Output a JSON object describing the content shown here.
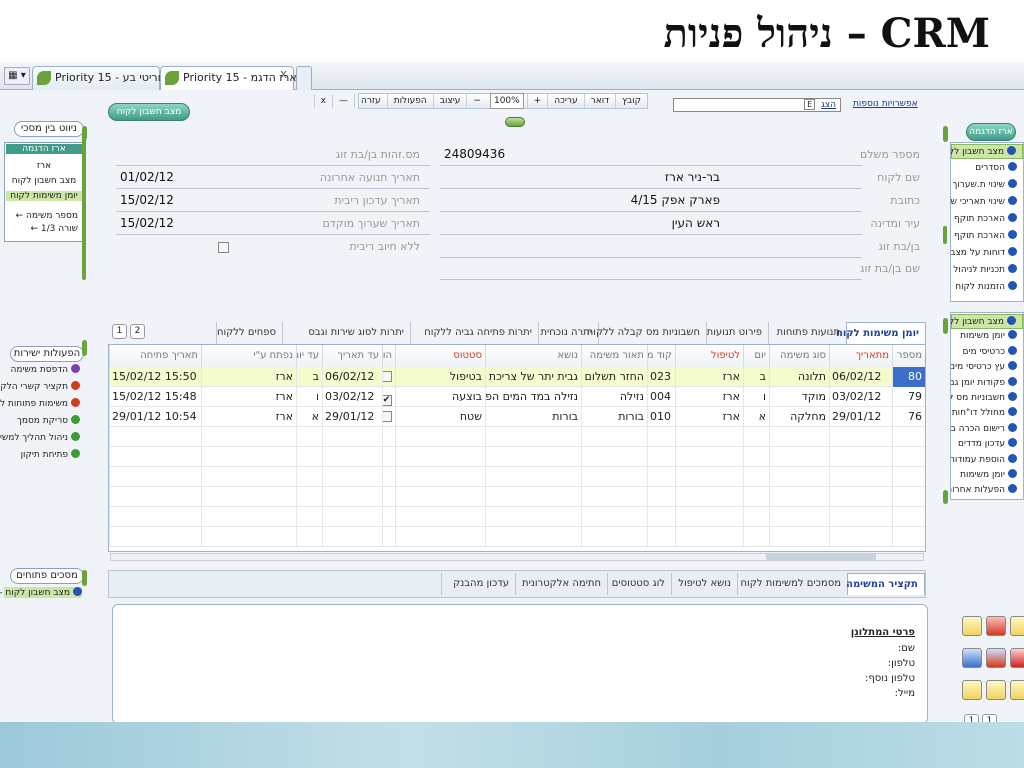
{
  "slide": {
    "title": "CRM – ניהול פניות"
  },
  "browser": {
    "tabs": [
      {
        "label": "Priority 15 - פריוריטי בע...",
        "active": false
      },
      {
        "label": "Priority 15 - ארז הדגמ...",
        "active": true
      }
    ],
    "close_glyph": "x"
  },
  "toolbar": {
    "items": [
      "קובץ",
      "דואר",
      "עריכה",
      "+",
      "100%",
      "−",
      "עיצוב",
      "הפעולות",
      "עזרה",
      "—",
      "x"
    ],
    "search_go": "הצג",
    "search_icon": "E",
    "more_options": "אפשרויות נוספות",
    "button_customer_status": "מצב חשבון לקוח"
  },
  "left_panel": {
    "nav_title": "ניווט בין מסכי",
    "nav_items": [
      "ארז הדגמה",
      "ארז",
      "מצב חשבון לקוח",
      "יומן משימות לקוח"
    ],
    "tree_items": [
      "מספר משימה",
      "שורה 1/3"
    ],
    "actions_title": "הפעולות ישירות",
    "actions": [
      {
        "label": "הדפסת משימה",
        "color": "#7a3fb0"
      },
      {
        "label": "תקציר קשרי הלקו",
        "color": "#d23a1e"
      },
      {
        "label": "משימות פתוחות ל",
        "color": "#d23a1e"
      },
      {
        "label": "סריקת מסמך",
        "color": "#3f9a3a"
      },
      {
        "label": "ניהול תהליך למשי",
        "color": "#3f9a3a"
      },
      {
        "label": "פתיחת תיקון",
        "color": "#3f9a3a"
      }
    ],
    "open_screens_title": "מסכים פתוחים",
    "open_screens": [
      "מצב חשבון לקוח -"
    ]
  },
  "right_nav": {
    "title": "ארז הדגמה",
    "group1": [
      "מצב חשבון לקוח",
      "הסדרים",
      "שינוי ת.שערוך בחש",
      "שינוי תאריכי שערוך",
      "הארכת תוקף הסדר",
      "הארכת תוקף כרטיס",
      "דוחות על מצב חשבו",
      "תכניות לניהול מצב ר",
      "הזמנות לקוח"
    ],
    "group2": [
      "מצב חשבון לקוח",
      "יומן משימות",
      "כרטיסי מים",
      "עץ כרטיסי מים",
      "פקודות יומן גביה",
      "חשבוניות מס קבלה",
      "מחולל דו\"חות ראשי",
      "רישום הכרה בהכנסו",
      "עדכון מדדים",
      "הוספת עמודות למסך",
      "יומן משימות",
      "הפעלות אחרונות"
    ]
  },
  "form": {
    "fields_right": [
      {
        "label": "מספר משלם",
        "value": "24809436"
      },
      {
        "label": "שם לקוח",
        "value": "בר-ניר ארז"
      },
      {
        "label": "כתובת",
        "value": "פארק אפק 4/15"
      },
      {
        "label": "עיר ומדינה",
        "value": "ראש העין"
      },
      {
        "label": "בן/בת זוג",
        "value": ""
      },
      {
        "label": "שם בן/בת זוג",
        "value": ""
      }
    ],
    "fields_left": [
      {
        "label": "מס.זהות בן/בת זוג",
        "value": ""
      },
      {
        "label": "תאריך תנועה אחרונה",
        "value": "01/02/12"
      },
      {
        "label": "תאריך עדכון ריבית",
        "value": "15/02/12"
      },
      {
        "label": "תאריך שערוך מוקדם",
        "value": "15/02/12"
      },
      {
        "label": "ללא חיוב ריבית",
        "value": ""
      }
    ]
  },
  "subform_tabs": {
    "items": [
      "יומן משימות לקוח",
      "תנועות פתוחות",
      "פירוט תנועות",
      "חשבוניות מס קבלה ללקוח",
      "יתרה נוכחית",
      "יתרות פתיחה גביה ללקוח",
      "יתרות לסוג שירות וגבס",
      "ספחים ללקוח"
    ],
    "pages": [
      "2",
      "1"
    ]
  },
  "grid": {
    "columns": [
      "מספר",
      "מתאריך",
      "סוג משימה",
      "יום",
      "לטיפול",
      "קוד מ",
      "תאור משימה",
      "נושא",
      "סטטוס",
      "הו",
      "עד תאריך",
      "עד יום",
      "נפתח ע\"י",
      "תאריך פתיחה"
    ],
    "rows": [
      {
        "num": "80",
        "from_date": "06/02/12",
        "type": "תלונה",
        "day": "ב",
        "handler": "ארז",
        "code": "023",
        "desc": "החזר תשלום",
        "subject": "גבית יתר של צריכת מים",
        "status": "בטיפול",
        "done": false,
        "to_date": "06/02/12",
        "to_day": "ב",
        "opened_by": "ארז",
        "opened_at": "15/02/12 15:50"
      },
      {
        "num": "79",
        "from_date": "03/02/12",
        "type": "מוקד",
        "day": "ו",
        "handler": "ארז",
        "code": "004",
        "desc": "נזילה",
        "subject": "נזילה במד המים הפרטי",
        "status": "בוצעה",
        "done": true,
        "to_date": "03/02/12",
        "to_day": "ו",
        "opened_by": "ארז",
        "opened_at": "15/02/12 15:48"
      },
      {
        "num": "76",
        "from_date": "29/01/12",
        "type": "מחלקה",
        "day": "א",
        "handler": "ארז",
        "code": "010",
        "desc": "בורות",
        "subject": "בורות",
        "status": "שטח",
        "done": false,
        "to_date": "29/01/12",
        "to_day": "א",
        "opened_by": "ארז",
        "opened_at": "29/01/12 10:54"
      }
    ]
  },
  "bottom_tabs": [
    "תקציר המשימה",
    "מסמכים למשימות לקוח",
    "נושא לטיפול",
    "לוג סטטוסים",
    "חתימה אלקטרונית",
    "עדכון מהבנק"
  ],
  "detail": {
    "title": "פרטי המתלונן",
    "lines": [
      "שם:",
      "טלפון:",
      "טלפון נוסף:",
      "מייל:"
    ]
  },
  "pager_bottom": [
    "1",
    "1"
  ]
}
